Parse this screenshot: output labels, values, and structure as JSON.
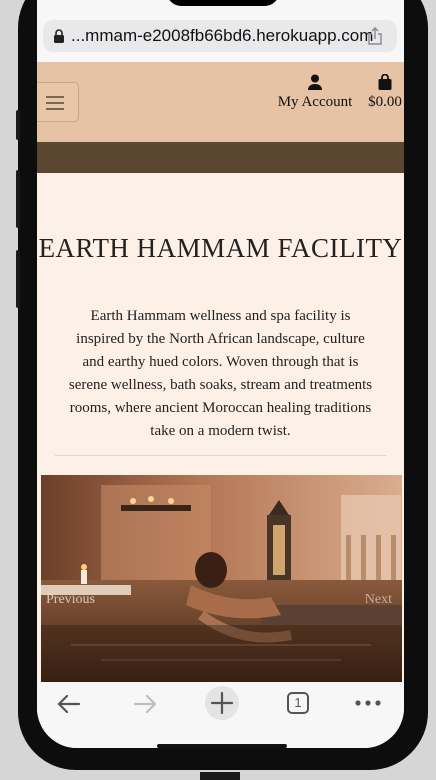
{
  "browser": {
    "url": "...mmam-e2008fb66bd6.herokuapp.com",
    "tabs_count": "1"
  },
  "header": {
    "account_label": "My Account",
    "cart_total": "$0.00"
  },
  "main": {
    "title": "EARTH HAMMAM FACILITY",
    "description": "Earth Hammam wellness and spa facility is inspired by the North African landscape, culture and earthy hued colors. Woven through that is serene wellness, bath soaks, stream and treatments rooms, where ancient Moroccan healing traditions take on a modern twist.",
    "carousel": {
      "prev_label": "Previous",
      "next_label": "Next"
    }
  },
  "colors": {
    "header_bg": "#e6c3a4",
    "band_bg": "#5b4731",
    "page_bg": "#fdf0e6"
  }
}
